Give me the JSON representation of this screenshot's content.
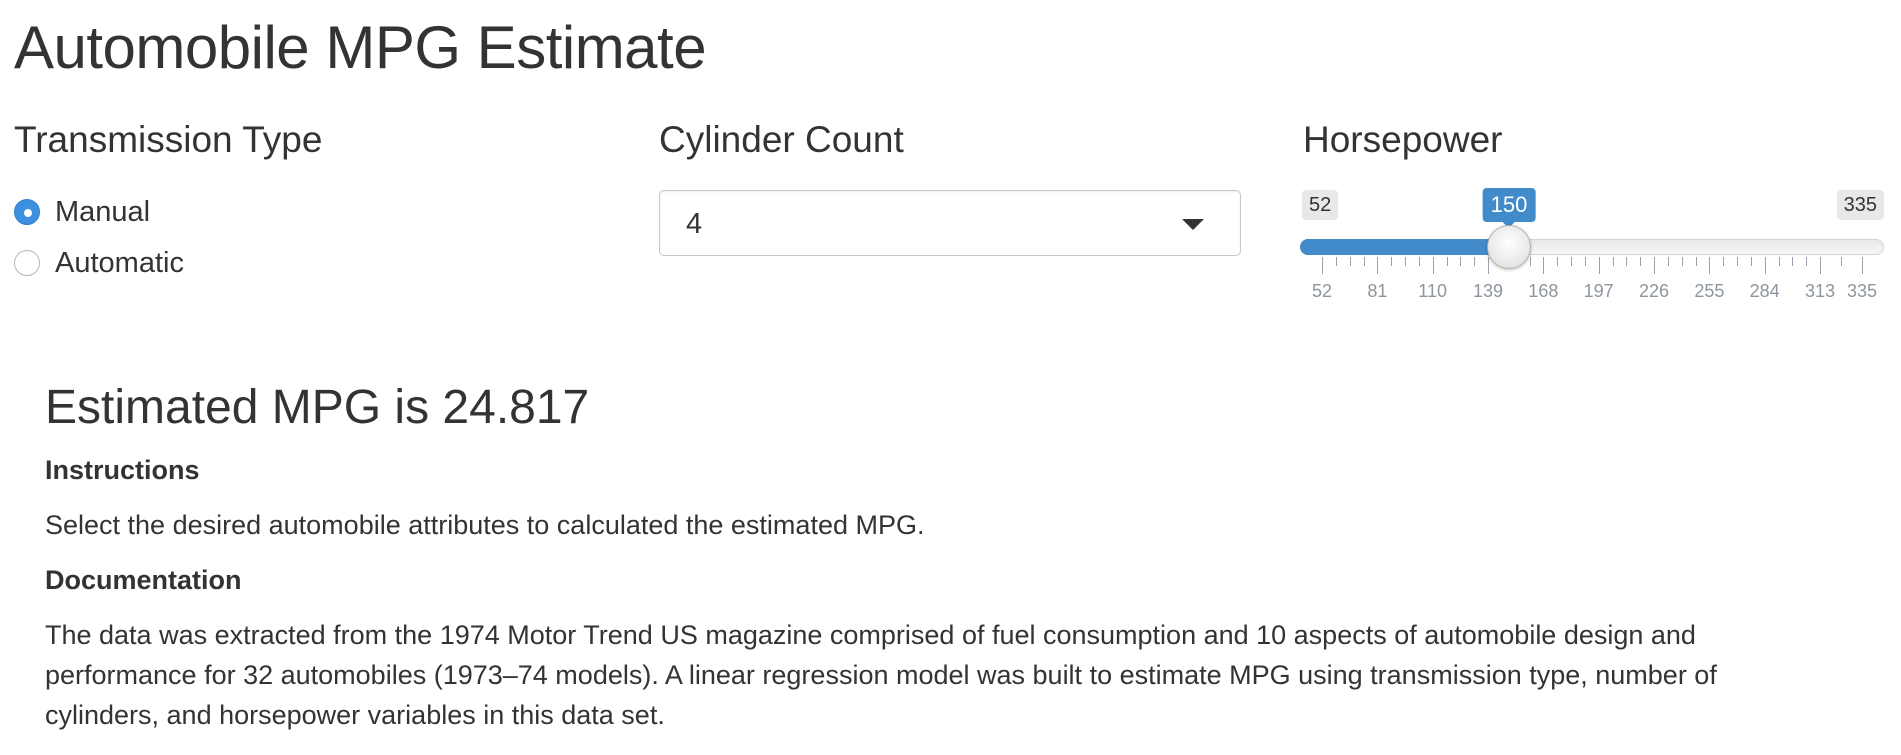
{
  "app": {
    "title": "Automobile MPG Estimate"
  },
  "transmission": {
    "label": "Transmission Type",
    "options": [
      {
        "label": "Manual",
        "selected": true
      },
      {
        "label": "Automatic",
        "selected": false
      }
    ]
  },
  "cylinders": {
    "label": "Cylinder Count",
    "selected_value": "4"
  },
  "horsepower": {
    "label": "Horsepower",
    "min": 52,
    "max": 335,
    "value": 150,
    "min_label": "52",
    "max_label": "335",
    "value_label": "150",
    "tick_labels": [
      "52",
      "81",
      "110",
      "139",
      "168",
      "197",
      "226",
      "255",
      "284",
      "313",
      "335"
    ]
  },
  "result": {
    "text": "Estimated MPG is 24.817"
  },
  "instructions": {
    "heading": "Instructions",
    "body": "Select the desired automobile attributes to calculated the estimated MPG."
  },
  "documentation": {
    "heading": "Documentation",
    "body": "The data was extracted from the 1974 Motor Trend US magazine comprised of fuel consumption and 10 aspects of automobile design and performance for 32 automobiles (1973–74 models). A linear regression model was built to estimate MPG using transmission type, number of cylinders, and horsepower variables in this data set."
  },
  "colors": {
    "accent": "#428bca",
    "text": "#333333",
    "tick_label": "#8d969e"
  }
}
